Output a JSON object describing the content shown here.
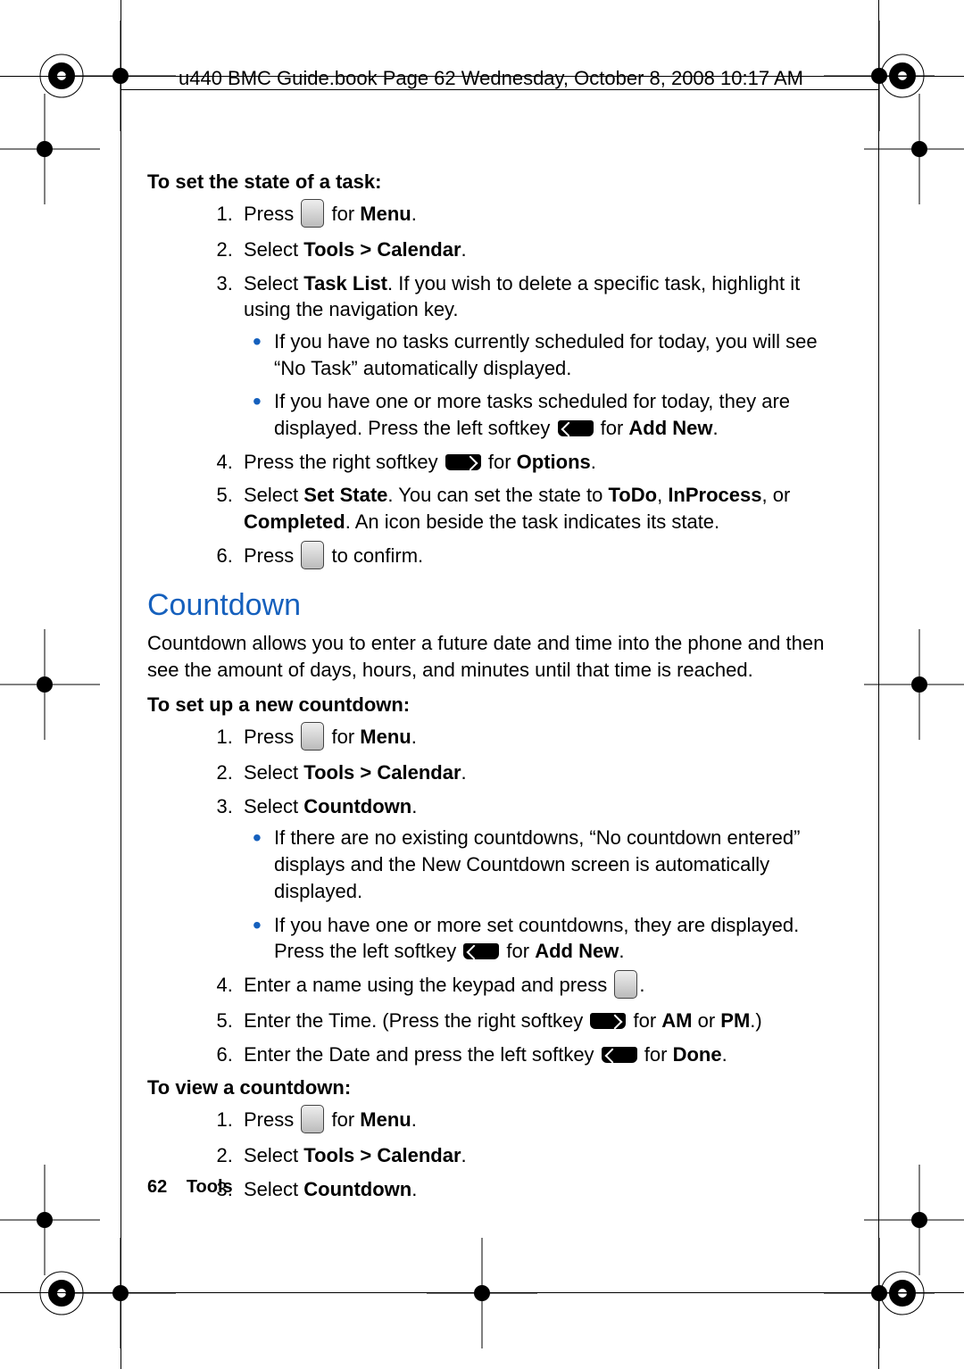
{
  "header": "u440 BMC Guide.book  Page 62  Wednesday, October 8, 2008  10:17 AM",
  "footer": {
    "page": "62",
    "section": "Tools"
  },
  "h1a": "To set the state of a task:",
  "s1": {
    "i1a": "Press ",
    "i1b": " for ",
    "i1c": "Menu",
    "i1d": ".",
    "i2a": "Select ",
    "i2b": "Tools > Calendar",
    "i2c": ".",
    "i3a": "Select ",
    "i3b": "Task List",
    "i3c": ". If you wish to delete a specific task, highlight it using the navigation key.",
    "b1": "If you have no tasks currently scheduled for today, you will see “No Task” automatically displayed.",
    "b2a": "If you have one or more tasks scheduled for today, they are displayed. Press the left softkey ",
    "b2b": " for ",
    "b2c": "Add New",
    "b2d": ".",
    "i4a": "Press the right softkey ",
    "i4b": " for ",
    "i4c": "Options",
    "i4d": ".",
    "i5a": "Select ",
    "i5b": "Set State",
    "i5c": ". You can set the state to ",
    "i5d": "ToDo",
    "i5e": ", ",
    "i5f": "InProcess",
    "i5g": ", or ",
    "i5h": "Completed",
    "i5i": ". An icon beside the task indicates its state.",
    "i6a": "Press ",
    "i6b": " to confirm."
  },
  "secTitle": "Countdown",
  "secIntro": "Countdown allows you to enter a future date and time into the phone and then see the amount of days, hours, and minutes until that time is reached.",
  "h1b": "To set up a new countdown:",
  "s2": {
    "i1a": "Press ",
    "i1b": " for ",
    "i1c": "Menu",
    "i1d": ".",
    "i2a": "Select ",
    "i2b": "Tools > Calendar",
    "i2c": ".",
    "i3a": "Select ",
    "i3b": "Countdown",
    "i3c": ".",
    "b1": "If there are no existing countdowns, “No countdown entered” displays and the New Countdown screen is automatically displayed.",
    "b2a": "If you have one or more set countdowns, they are displayed. Press the left softkey ",
    "b2b": " for ",
    "b2c": "Add New",
    "b2d": ".",
    "i4a": "Enter a name using the keypad and press ",
    "i4b": ".",
    "i5a": "Enter the Time. (Press the right softkey ",
    "i5b": " for ",
    "i5c": "AM",
    "i5d": " or ",
    "i5e": "PM",
    "i5f": ".)",
    "i6a": "Enter the Date and press the left softkey ",
    "i6b": " for ",
    "i6c": "Done",
    "i6d": "."
  },
  "h1c": "To view a countdown:",
  "s3": {
    "i1a": "Press ",
    "i1b": " for ",
    "i1c": "Menu",
    "i1d": ".",
    "i2a": "Select ",
    "i2b": "Tools > Calendar",
    "i2c": ".",
    "i3a": "Select ",
    "i3b": "Countdown",
    "i3c": "."
  }
}
